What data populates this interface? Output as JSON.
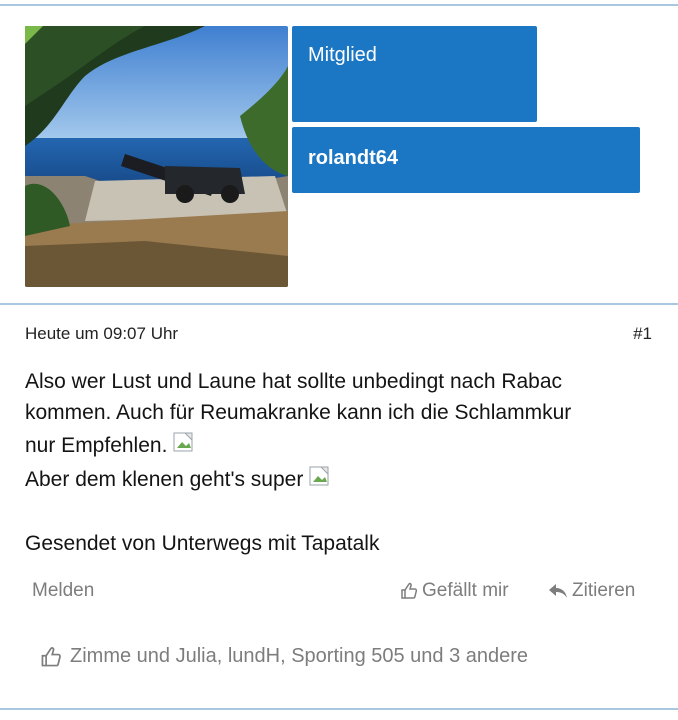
{
  "post": {
    "role": "Mitglied",
    "username": "rolandt64",
    "time": "Heute um 09:07 Uhr",
    "number": "#1",
    "body_line1": "Also wer Lust und Laune hat sollte unbedingt nach Rabac",
    "body_line2": "kommen. Auch für Reumakranke kann ich die Schlammkur",
    "body_line3": "nur Empfehlen.",
    "body_line4": "Aber dem klenen geht's super",
    "signature": "Gesendet von Unterwegs mit Tapatalk"
  },
  "actions": {
    "report": "Melden",
    "like": "Gefällt mir",
    "quote": "Zitieren"
  },
  "likes_summary": "Zimme und Julia, lundH, Sporting 505 und 3 andere",
  "icons": {
    "like": "thumbs-up-icon",
    "quote": "reply-arrow-icon",
    "broken_image": "broken-image-icon"
  },
  "colors": {
    "banner": "#1b76c3",
    "divider": "#a9c7e1",
    "muted": "#7d7d7d",
    "online": "#7ab84a"
  }
}
